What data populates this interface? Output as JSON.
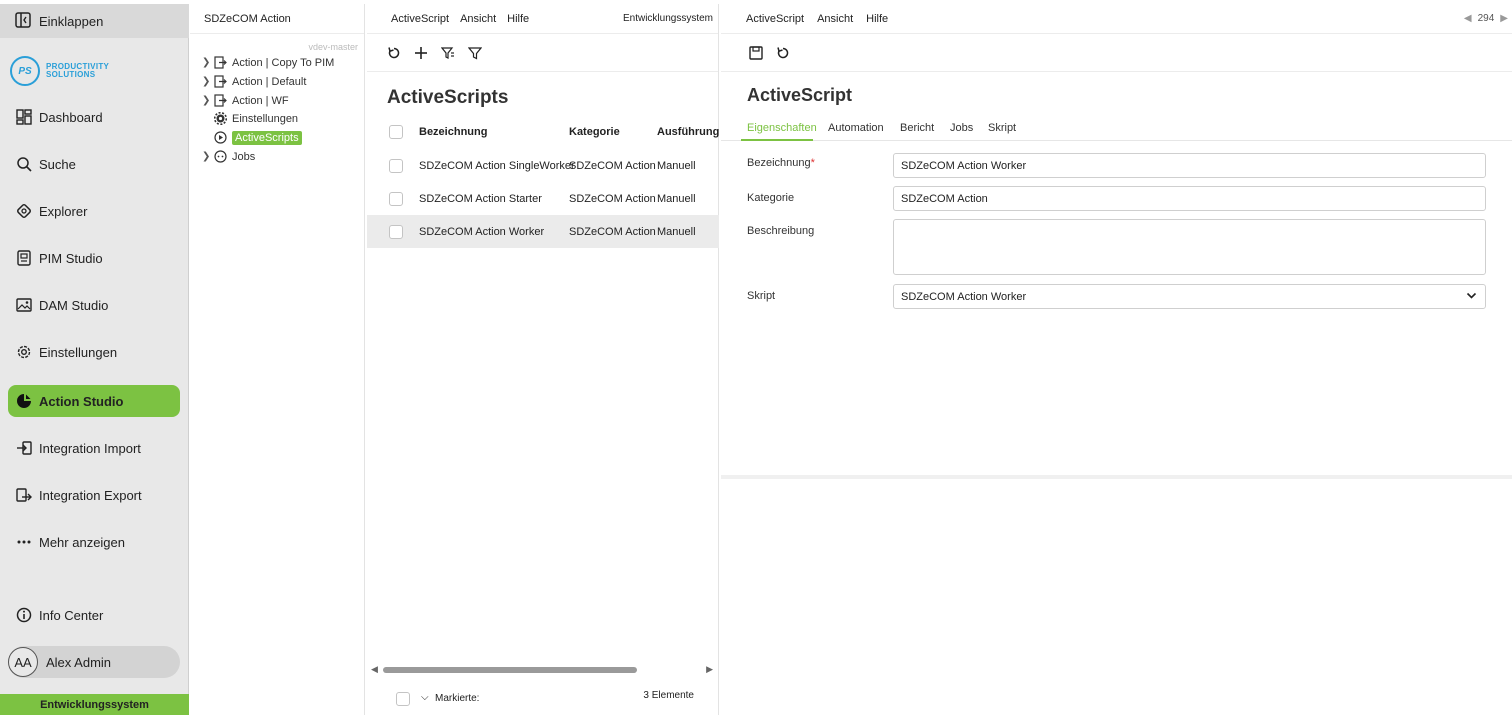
{
  "sidebar": {
    "collapse_label": "Einklappen",
    "logo": {
      "mark": "PS",
      "line1": "PRODUCTIVITY",
      "line2": "SOLUTIONS"
    },
    "items": [
      {
        "label": "Dashboard",
        "icon": "dashboard-icon"
      },
      {
        "label": "Suche",
        "icon": "search-icon"
      },
      {
        "label": "Explorer",
        "icon": "explorer-icon"
      },
      {
        "label": "PIM Studio",
        "icon": "pim-icon"
      },
      {
        "label": "DAM Studio",
        "icon": "image-icon"
      },
      {
        "label": "Einstellungen",
        "icon": "gear-icon"
      },
      {
        "label": "Action Studio",
        "icon": "action-icon",
        "active": true
      },
      {
        "label": "Integration Import",
        "icon": "import-icon"
      },
      {
        "label": "Integration Export",
        "icon": "export-icon"
      },
      {
        "label": "Mehr anzeigen",
        "icon": "more-icon"
      }
    ],
    "info_center": "Info Center",
    "user": {
      "initials": "AA",
      "name": "Alex Admin"
    },
    "environment": "Entwicklungssystem",
    "accent": "#7cc242"
  },
  "tree": {
    "title": "SDZeCOM Action",
    "branch": "vdev-master",
    "items": [
      {
        "label": "Action | Copy To PIM",
        "expandable": true
      },
      {
        "label": "Action | Default",
        "expandable": true
      },
      {
        "label": "Action | WF",
        "expandable": true
      },
      {
        "label": "Einstellungen",
        "expandable": false
      },
      {
        "label": "ActiveScripts",
        "expandable": false,
        "selected": true
      },
      {
        "label": "Jobs",
        "expandable": true
      }
    ]
  },
  "list": {
    "menu": [
      "ActiveScript",
      "Ansicht",
      "Hilfe"
    ],
    "environment": "Entwicklungssystem",
    "title": "ActiveScripts",
    "columns": [
      "Bezeichnung",
      "Kategorie",
      "Ausführung"
    ],
    "rows": [
      {
        "name": "SDZeCOM Action SingleWorker",
        "category": "SDZeCOM Action",
        "execution": "Manuell"
      },
      {
        "name": "SDZeCOM Action Starter",
        "category": "SDZeCOM Action",
        "execution": "Manuell"
      },
      {
        "name": "SDZeCOM Action Worker",
        "category": "SDZeCOM Action",
        "execution": "Manuell",
        "selected": true
      }
    ],
    "footer": {
      "marked_label": "Markierte:",
      "count": "3 Elemente"
    }
  },
  "detail": {
    "menu": [
      "ActiveScript",
      "Ansicht",
      "Hilfe"
    ],
    "pager": "294",
    "title": "ActiveScript",
    "tabs": [
      "Eigenschaften",
      "Automation",
      "Bericht",
      "Jobs",
      "Skript"
    ],
    "active_tab": "Eigenschaften",
    "fields": {
      "bezeichnung": {
        "label": "Bezeichnung",
        "value": "SDZeCOM Action Worker"
      },
      "kategorie": {
        "label": "Kategorie",
        "value": "SDZeCOM Action"
      },
      "beschreibung": {
        "label": "Beschreibung",
        "value": ""
      },
      "skript": {
        "label": "Skript",
        "value": "SDZeCOM Action Worker"
      }
    }
  }
}
